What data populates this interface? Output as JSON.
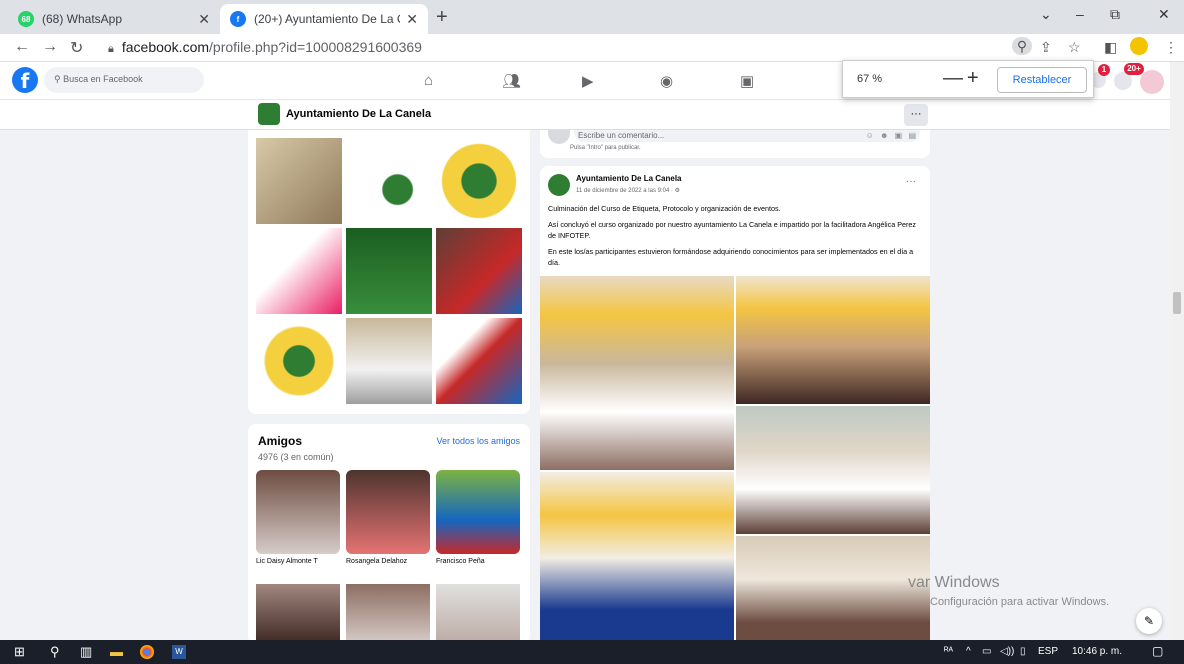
{
  "browser": {
    "tabs": [
      {
        "title": "(68) WhatsApp",
        "favicon_badge": "68",
        "active": false
      },
      {
        "title": "(20+) Ayuntamiento De La Canel",
        "active": true
      }
    ],
    "new_tab": "+",
    "url_host": "facebook.com",
    "url_path": "/profile.php?id=100008291600369",
    "window_controls": [
      "⌄",
      "–",
      "⧉",
      "✕"
    ]
  },
  "zoom": {
    "value": "67 %",
    "minus": "—",
    "plus": "+",
    "reset_label": "Restablecer"
  },
  "fb_header": {
    "logo": "f",
    "search_placeholder": "Busca en Facebook",
    "messenger_badge": "1",
    "notif_badge": "20+"
  },
  "page_bar": {
    "name": "Ayuntamiento De La Canela",
    "more": "···"
  },
  "friends": {
    "heading": "Amigos",
    "see_all": "Ver todos los amigos",
    "count": "4976 (3 en común)",
    "items": [
      {
        "name": "Lic Daisy Almonte T"
      },
      {
        "name": "Rosangela Delahoz"
      },
      {
        "name": "Francisco Peña"
      }
    ]
  },
  "comment_box": {
    "placeholder": "Escribe un comentario...",
    "hint": "Pulsa \"Intro\" para publicar."
  },
  "post": {
    "author": "Ayuntamiento De La Canela",
    "date": "11 de diciembre de 2022 a las 9:04 · ⚙",
    "more": "···",
    "paragraphs": [
      "Culminación del Curso de Etiqueta, Protocolo y organización de eventos.",
      "Así concluyó el curso organizado por nuestro ayuntamiento La Canela e impartido por la facilitadora Angélica Perez  de INFOTEP.",
      "En este los/as participantes estuvieron  formándose adquiriendo conocimientos para ser implementados en el día a día."
    ]
  },
  "watermark": {
    "line1": "var Windows",
    "line2": "Configuración para activar Windows."
  },
  "taskbar": {
    "tray_lang": "ESP",
    "time": "10:46 p. m."
  },
  "colors": {
    "fb_blue": "#1877f2",
    "link_blue": "#216fdb",
    "badge_red": "#e41e3f"
  }
}
